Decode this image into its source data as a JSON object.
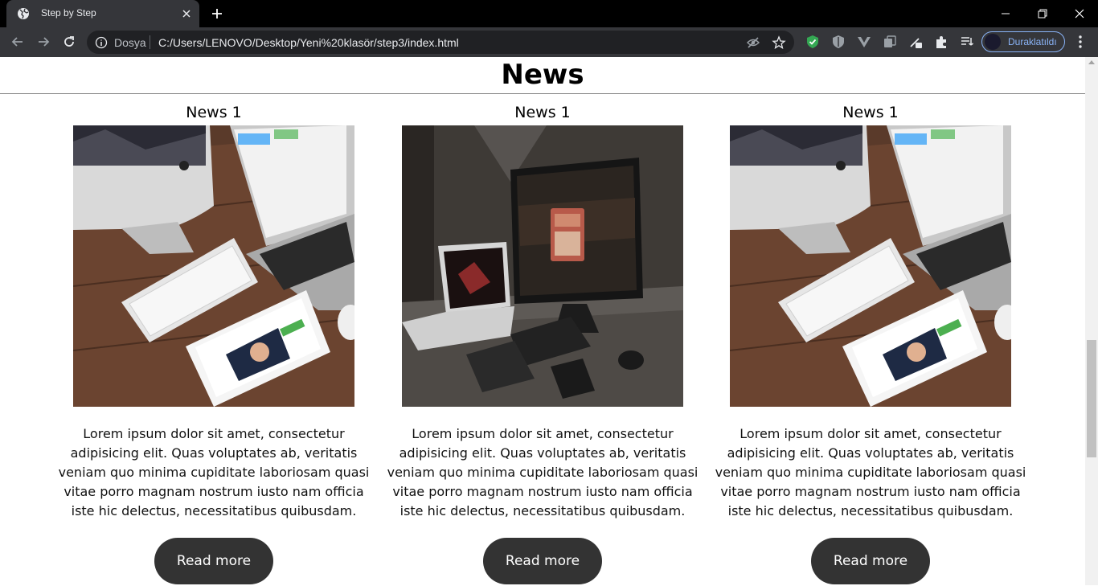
{
  "browser": {
    "tab_title": "Step by Step",
    "address_scheme": "Dosya",
    "address_url": "C:/Users/LENOVO/Desktop/Yeni%20klasör/step3/index.html",
    "profile_label": "Duraklatıldı",
    "accent_color": "#8ab4f8"
  },
  "page": {
    "title": "News",
    "cards": [
      {
        "title": "News 1",
        "image": "imac-macbook-ipad-desk-photo",
        "text": "Lorem ipsum dolor sit amet, consectetur adipisicing elit. Quas voluptates ab, veritatis veniam quo minima cupiditate laboriosam quasi vitae porro magnam nostrum iusto nam officia iste hic delectus, necessitatibus quibusdam.",
        "button_label": "Read more"
      },
      {
        "title": "News 1",
        "image": "dark-desk-monitor-open-sign-photo",
        "text": "Lorem ipsum dolor sit amet, consectetur adipisicing elit. Quas voluptates ab, veritatis veniam quo minima cupiditate laboriosam quasi vitae porro magnam nostrum iusto nam officia iste hic delectus, necessitatibus quibusdam.",
        "button_label": "Read more"
      },
      {
        "title": "News 1",
        "image": "imac-macbook-ipad-desk-photo",
        "text": "Lorem ipsum dolor sit amet, consectetur adipisicing elit. Quas voluptates ab, veritatis veniam quo minima cupiditate laboriosam quasi vitae porro magnam nostrum iusto nam officia iste hic delectus, necessitatibus quibusdam.",
        "button_label": "Read more"
      }
    ],
    "button_color": "#333333"
  }
}
